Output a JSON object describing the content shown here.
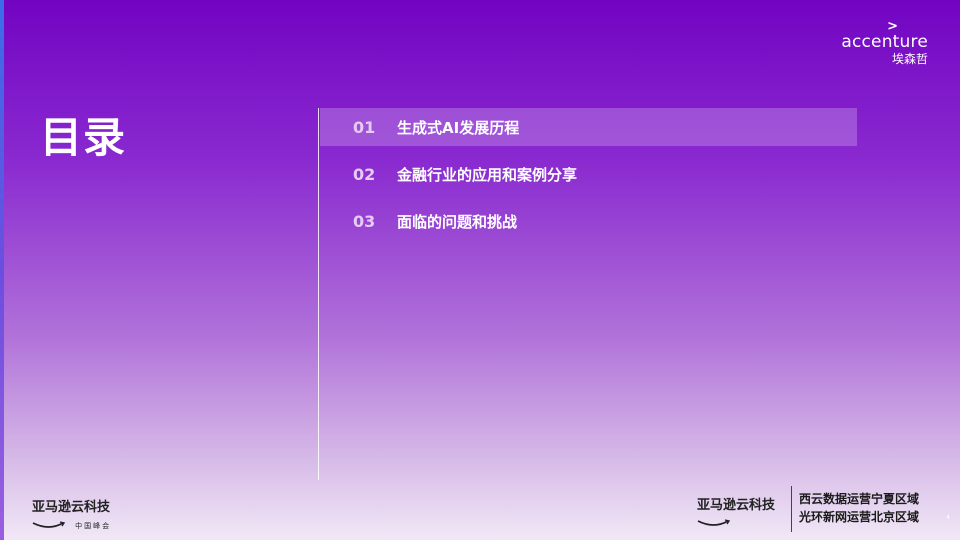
{
  "title": "目录",
  "toc": [
    {
      "num": "01",
      "label": "生成式AI发展历程",
      "active": true
    },
    {
      "num": "02",
      "label": "金融行业的应用和案例分享",
      "active": false
    },
    {
      "num": "03",
      "label": "面临的问题和挑战",
      "active": false
    }
  ],
  "accenture": {
    "caret": ">",
    "word": "accenture",
    "cn": "埃森哲"
  },
  "footer": {
    "aws_left_name": "亚马逊云科技",
    "aws_left_sub": "中国峰会",
    "aws_right_name": "亚马逊云科技",
    "region_line1": "西云数据运营宁夏区域",
    "region_line2": "光环新网运营北京区域"
  },
  "page_number": "4",
  "colors": {
    "bg_top": "#7204c2",
    "bg_bottom": "#f1e8f6",
    "aws_smile": "#222222"
  }
}
